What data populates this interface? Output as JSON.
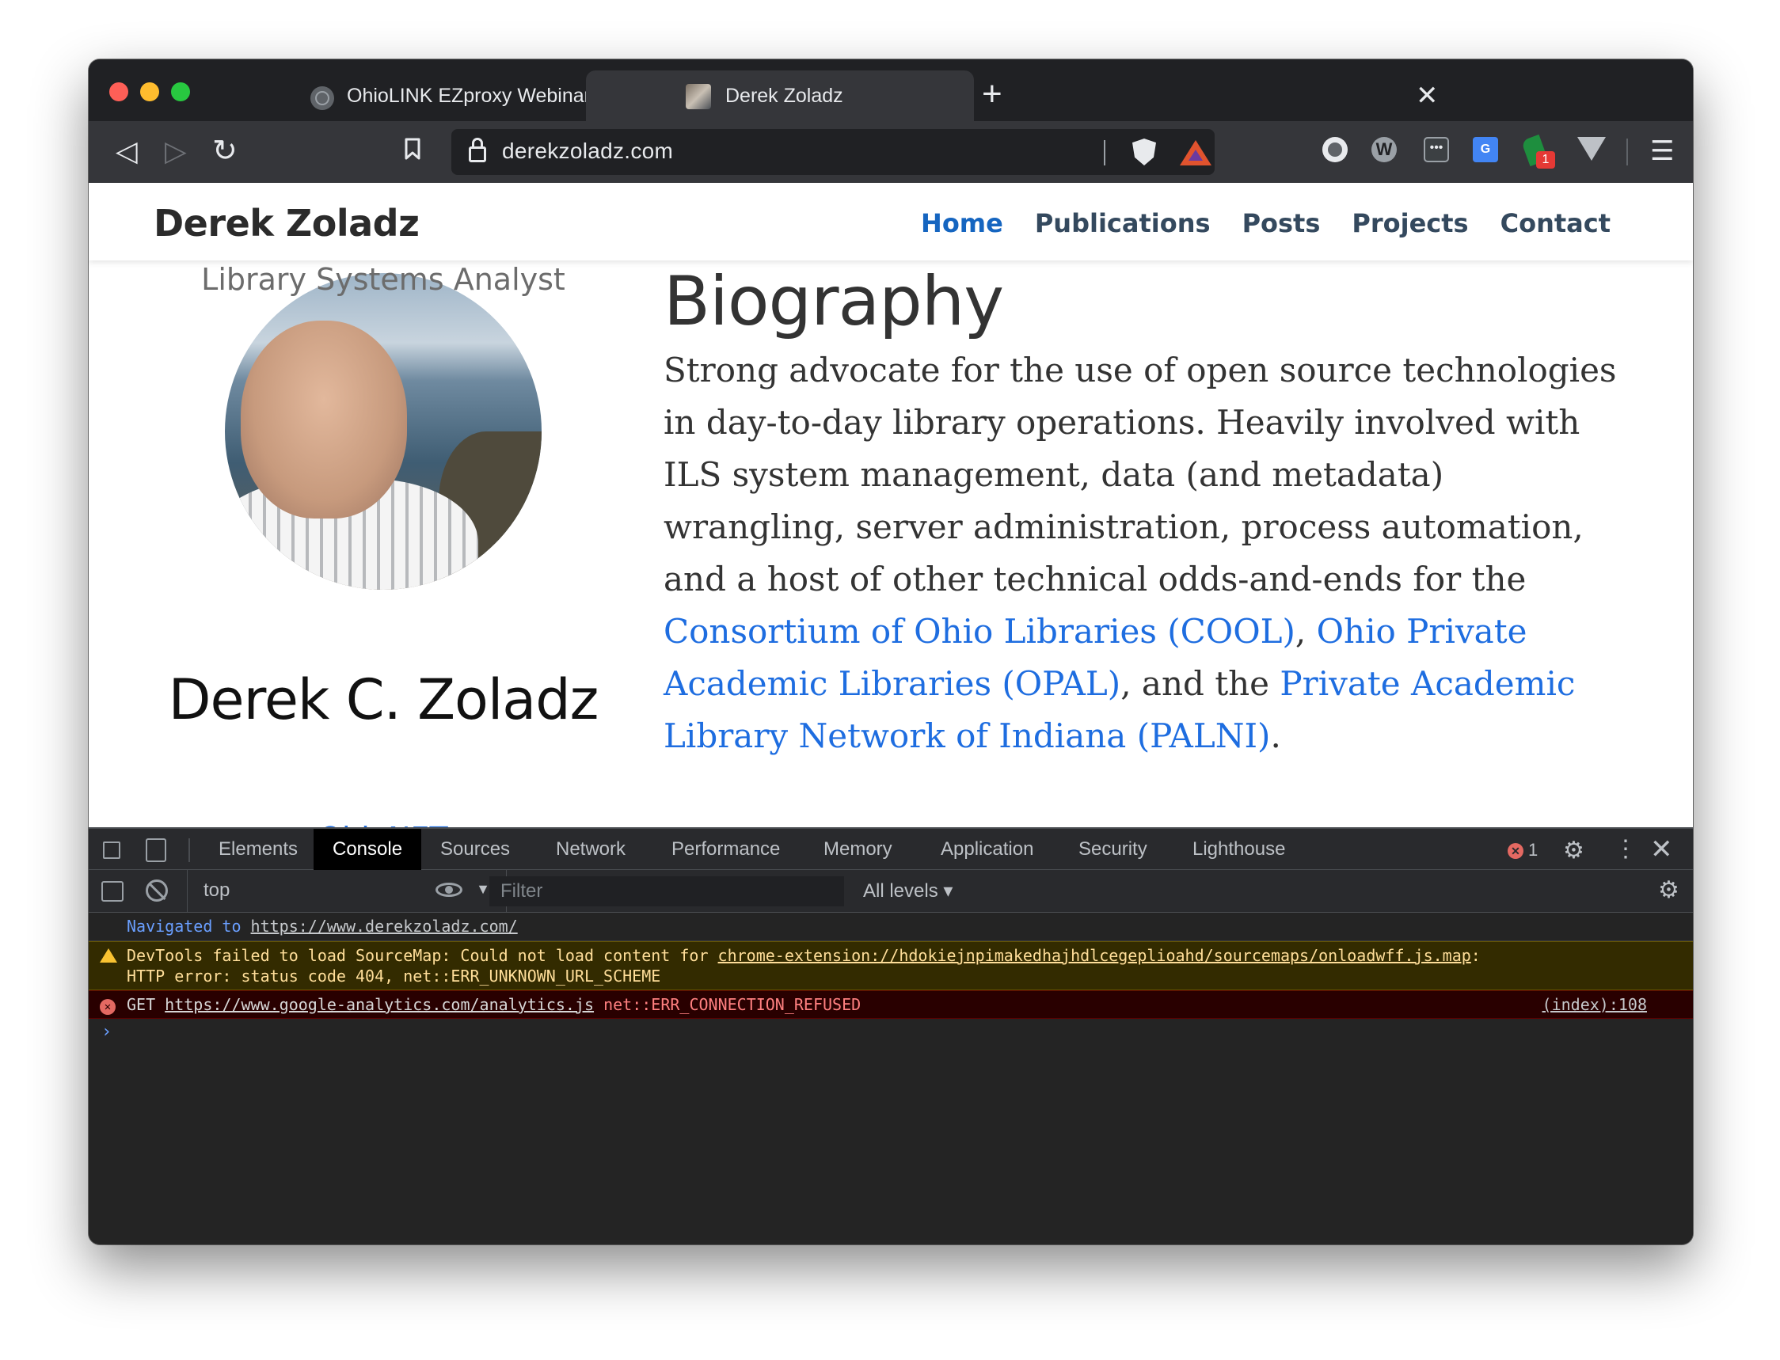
{
  "browser": {
    "tabs": [
      {
        "title": "OhioLINK EZproxy Webinar",
        "close": "✕"
      },
      {
        "title": "Derek Zoladz",
        "close": "✕"
      }
    ],
    "new_tab": "+",
    "url": "derekzoladz.com",
    "extension_badge": "1",
    "icons": {
      "back": "back-arrow-icon",
      "forward": "forward-arrow-icon",
      "reload": "reload-icon",
      "bookmark": "bookmark-icon",
      "lock": "lock-icon",
      "menu": "hamburger-menu-icon"
    }
  },
  "site": {
    "brand": "Derek Zoladz",
    "nav": [
      "Home",
      "Publications",
      "Posts",
      "Projects",
      "Contact"
    ],
    "active_nav": "Home",
    "profile": {
      "name": "Derek C. Zoladz",
      "role": "Library Systems Analyst",
      "org": "OhioNET"
    },
    "bio": {
      "title": "Biography",
      "text_1": "Strong advocate for the use of open source technologies in day-to-day library operations. Heavily involved with ILS system management, data (and metadata) wrangling, server administration, process automation, and a host of other technical odds-and-ends for the ",
      "link_1": "Consortium of Ohio Libraries (COOL)",
      "text_2": ", ",
      "link_2": "Ohio Private Academic Libraries (OPAL)",
      "text_3": ", and the ",
      "link_3": "Private Academic Library Network of Indiana (PALNI)",
      "text_4": "."
    }
  },
  "devtools": {
    "tabs": [
      "Elements",
      "Console",
      "Sources",
      "Network",
      "Performance",
      "Memory",
      "Application",
      "Security",
      "Lighthouse"
    ],
    "selected_tab": "Console",
    "error_count": "1",
    "close": "✕",
    "context": "top",
    "filter_placeholder": "Filter",
    "levels": "All levels ▾",
    "messages": {
      "nav_prefix": "Navigated to ",
      "nav_url": "https://www.derekzoladz.com/",
      "warn_text_1": "DevTools failed to load SourceMap: Could not load content for ",
      "warn_url": "chrome-extension://hdokiejnpimakedhajhdlcegeplioahd/sourcemaps/onloadwff.js.map",
      "warn_text_2": ":",
      "warn_line_2": "HTTP error: status code 404, net::ERR_UNKNOWN_URL_SCHEME",
      "err_method": "GET ",
      "err_url": "https://www.google-analytics.com/analytics.js",
      "err_text": " net::ERR_CONNECTION_REFUSED",
      "err_source": "(index):108",
      "prompt": "›"
    }
  },
  "colors": {
    "link": "#1e6de0",
    "nav_active": "#1565c0",
    "nav": "#34495e",
    "warning_bg": "#332b00",
    "error_bg": "#290000"
  }
}
